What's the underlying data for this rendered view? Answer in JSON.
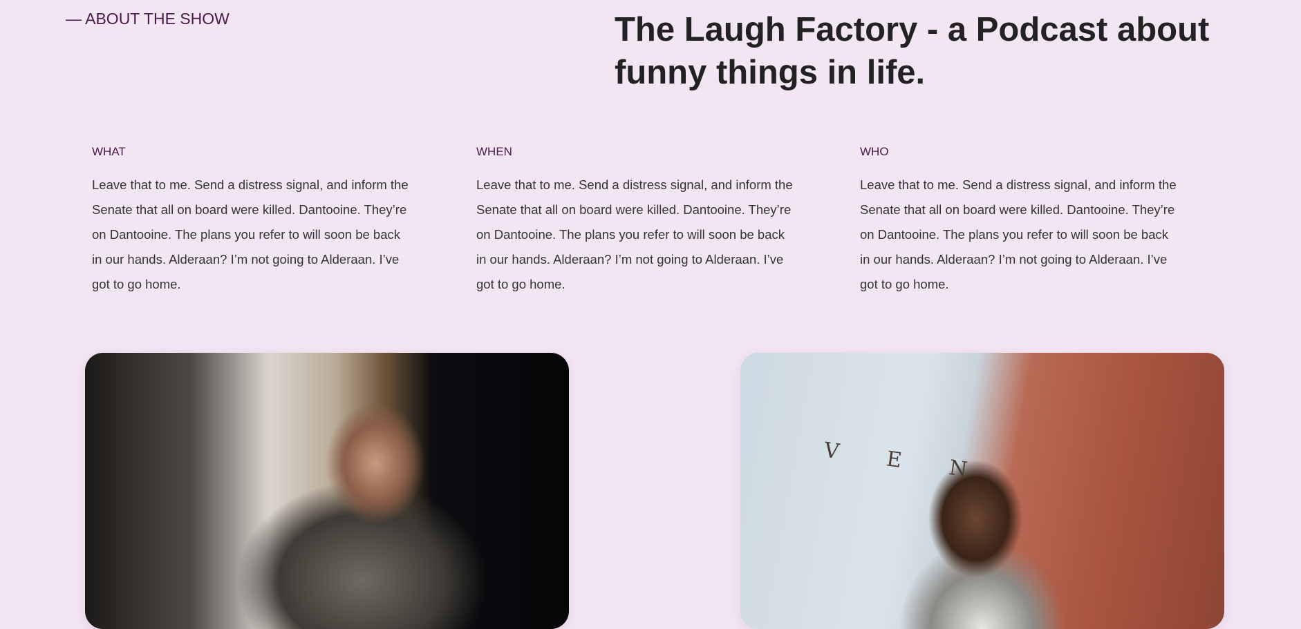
{
  "about": {
    "eyebrow": "— ABOUT THE SHOW",
    "title": "The Laugh Factory - a Podcast about funny things in life."
  },
  "columns": [
    {
      "heading": "WHAT",
      "body": "Leave that to me. Send a distress signal, and inform the Senate that all on board were killed. Dantooine. They’re on Dantooine. The plans you refer to will soon be back in our hands. Alderaan? I’m not going to Alderaan. I’ve got to go home."
    },
    {
      "heading": "WHEN",
      "body": "Leave that to me. Send a distress signal, and inform the Senate that all on board were killed. Dantooine. They’re on Dantooine. The plans you refer to will soon be back in our hands. Alderaan? I’m not going to Alderaan. I’ve got to go home."
    },
    {
      "heading": "WHO",
      "body": "Leave that to me. Send a distress signal, and inform the Senate that all on board were killed. Dantooine. They’re on Dantooine. The plans you refer to will soon be back in our hands. Alderaan? I’m not going to Alderaan. I’ve got to go home."
    }
  ],
  "images": [
    {
      "subject": "podcaster-in-studio-photo"
    },
    {
      "subject": "man-with-headphones-street-photo",
      "sign_text": "V E N"
    }
  ],
  "colors": {
    "background": "#f3e6f3",
    "accent": "#4a1a4a",
    "heading": "#222222"
  }
}
